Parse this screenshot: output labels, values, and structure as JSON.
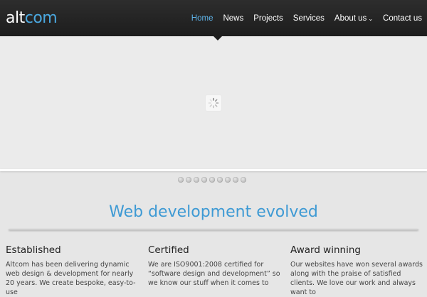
{
  "logo": {
    "part1": "alt",
    "part2": "com"
  },
  "nav": {
    "items": [
      "Home",
      "News",
      "Projects",
      "Services",
      "About us",
      "Contact us"
    ],
    "active": "Home",
    "dropdown_icon": "chevron-down-icon"
  },
  "headline": "Web development evolved",
  "features": [
    {
      "title": "Established",
      "text": "Altcom has been delivering dynamic web design & development for nearly 20 years. We create bespoke, easy-to-use"
    },
    {
      "title": "Certified",
      "text": "We are ISO9001:2008 certified for “software design and development” so we know our stuff when it comes to"
    },
    {
      "title": "Award winning",
      "text": "Our websites have won several awards along with the praise of satisfied clients. We love our work and always want to"
    }
  ],
  "colors": {
    "accent": "#4aa8e0",
    "nav_bg": "#222222",
    "body_bg": "#e6e6e6"
  }
}
